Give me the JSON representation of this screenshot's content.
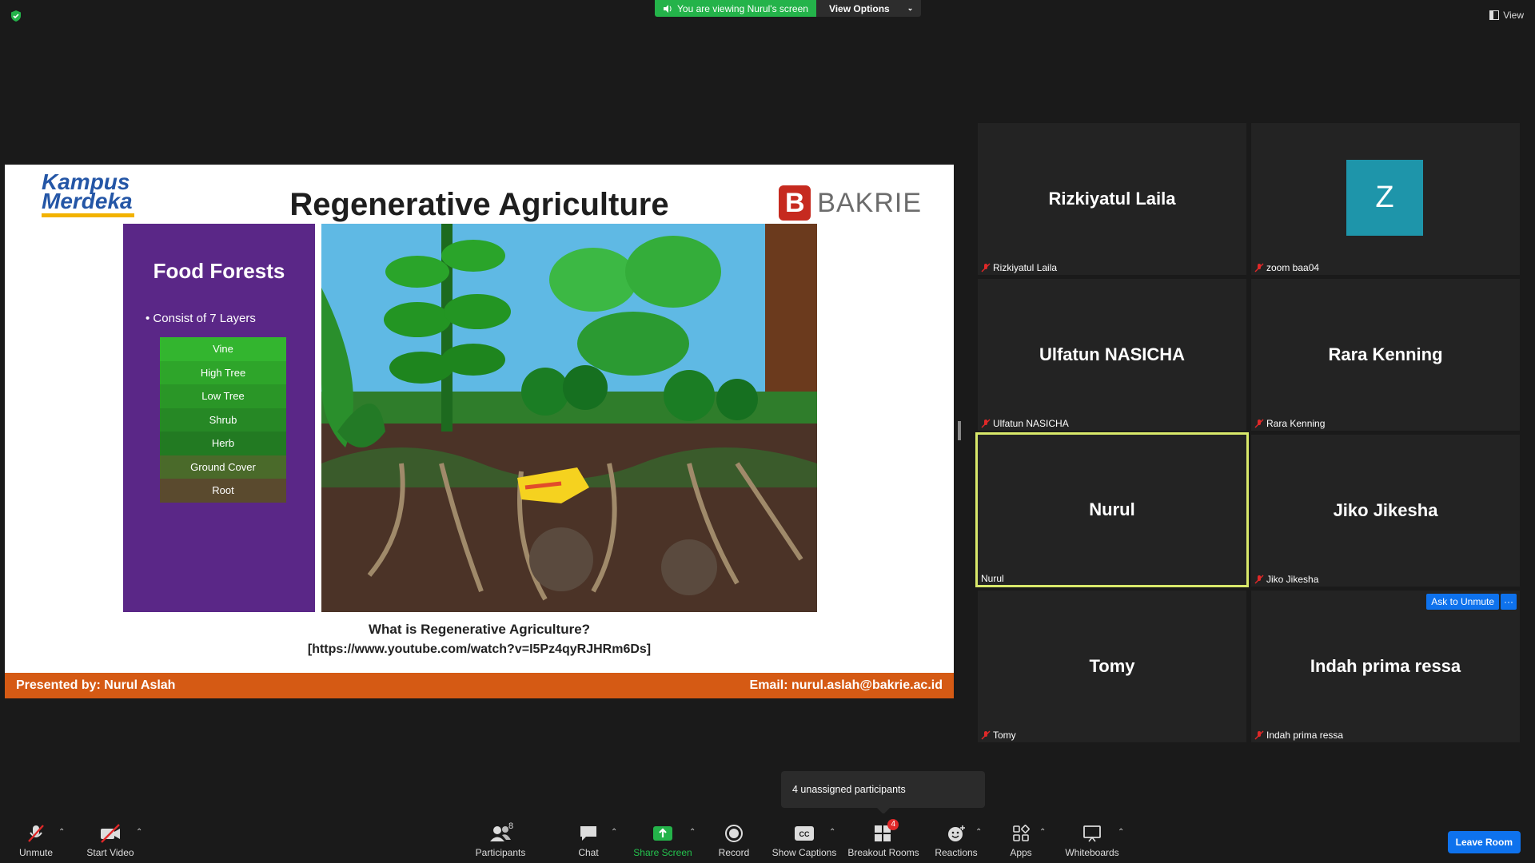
{
  "banner": {
    "viewing_text": "You are viewing Nurul's screen",
    "view_options": "View Options",
    "view_label": "View"
  },
  "slide": {
    "title": "Regenerative Agriculture",
    "logo_left": [
      "Kampus",
      "Merdeka"
    ],
    "logo_right": "BAKRIE",
    "logo_right_letter": "B",
    "panel_title": "Food Forests",
    "bullet": "Consist of 7 Layers",
    "layers": [
      "Vine",
      "High Tree",
      "Low Tree",
      "Shrub",
      "Herb",
      "Ground Cover",
      "Root"
    ],
    "layer_colors": [
      "#33b52f",
      "#2ea52a",
      "#2a9627",
      "#268825",
      "#227a22",
      "#4a6a2a",
      "#5a4a2e"
    ],
    "question": "What is Regenerative Agriculture?",
    "link": "[https://www.youtube.com/watch?v=I5Pz4qyRJHRm6Ds]",
    "presented_by": "Presented by: Nurul Aslah",
    "email": "Email: nurul.aslah@bakrie.ac.id"
  },
  "participants": [
    {
      "display": "Rizkiyatul Laila",
      "label": "Rizkiyatul Laila",
      "muted": true
    },
    {
      "display": "Z",
      "label": "zoom baa04",
      "muted": true,
      "avatar": true
    },
    {
      "display": "Ulfatun NASICHA",
      "label": "Ulfatun NASICHA",
      "muted": true
    },
    {
      "display": "Rara Kenning",
      "label": "Rara Kenning",
      "muted": true
    },
    {
      "display": "Nurul",
      "label": "Nurul",
      "muted": false,
      "active": true
    },
    {
      "display": "Jiko Jikesha",
      "label": "Jiko Jikesha",
      "muted": true
    },
    {
      "display": "Tomy",
      "label": "Tomy",
      "muted": true
    },
    {
      "display": "Indah prima ressa",
      "label": "Indah prima ressa",
      "muted": true
    }
  ],
  "tile_actions": {
    "ask_to_unmute": "Ask to Unmute",
    "more": "···"
  },
  "tooltip": "4 unassigned participants",
  "toolbar": {
    "unmute": "Unmute",
    "start_video": "Start Video",
    "participants": "Participants",
    "participants_count": "8",
    "chat": "Chat",
    "share_screen": "Share Screen",
    "record": "Record",
    "show_captions": "Show Captions",
    "breakout_rooms": "Breakout Rooms",
    "breakout_badge": "4",
    "reactions": "Reactions",
    "apps": "Apps",
    "whiteboards": "Whiteboards",
    "leave": "Leave Room"
  },
  "colors": {
    "accent_blue": "#0e72ed",
    "green": "#24b34a",
    "active_border": "#d8e86a",
    "panel_purple": "#5a2787",
    "footer_orange": "#d55a14"
  }
}
